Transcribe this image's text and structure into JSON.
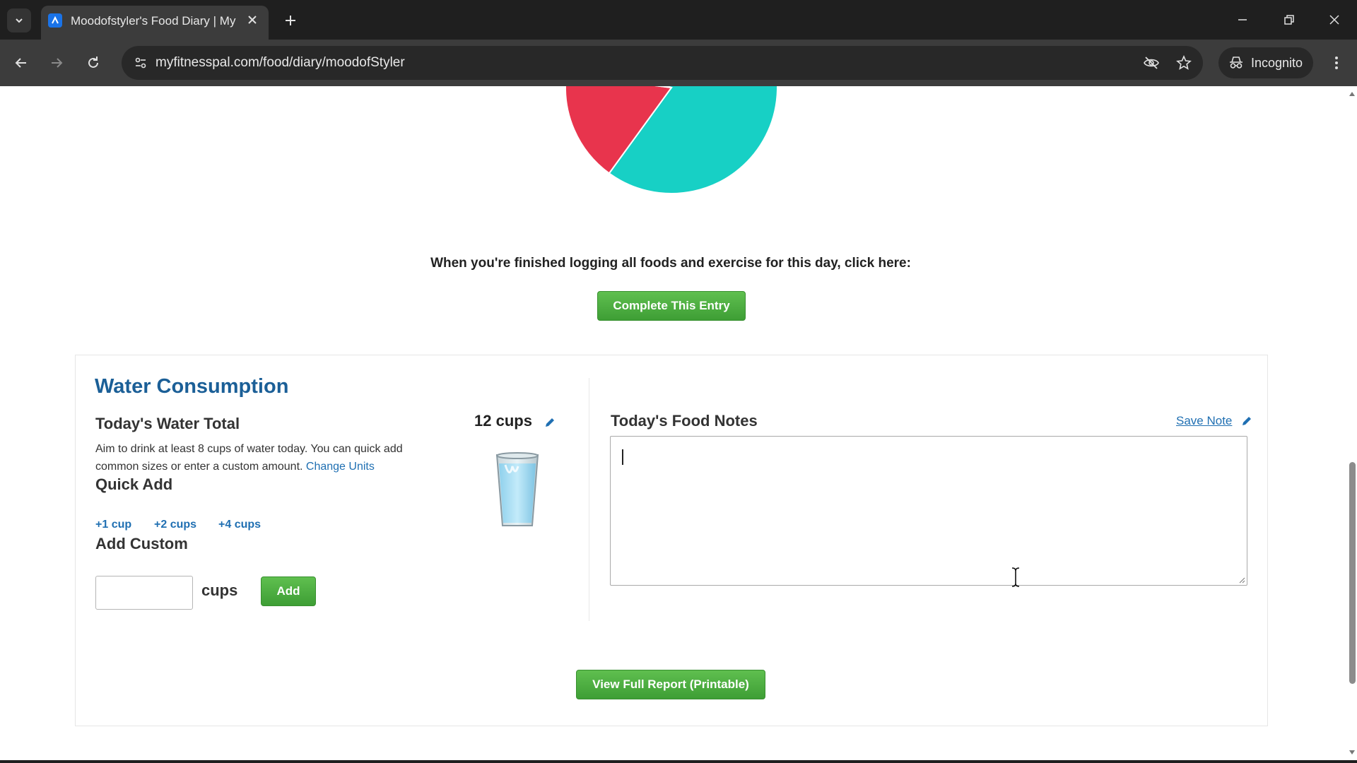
{
  "browser": {
    "tab_title": "Moodofstyler's Food Diary | My",
    "url": "myfitnesspal.com/food/diary/moodofStyler",
    "incognito_label": "Incognito"
  },
  "macro_pie": {
    "slices": [
      {
        "color": "#17d0c5",
        "fraction": 0.8
      },
      {
        "color": "#e8344d",
        "fraction": 0.17
      },
      {
        "color": "#b93ccf",
        "fraction": 0.03
      }
    ]
  },
  "entry": {
    "finish_prompt": "When you're finished logging all foods and exercise for this day, click here:",
    "complete_button": "Complete This Entry"
  },
  "water": {
    "title": "Water Consumption",
    "total_heading": "Today's Water Total",
    "description": "Aim to drink at least 8 cups of water today. You can quick add common sizes or enter a custom amount.",
    "change_units": "Change Units",
    "total_value": "12 cups",
    "quick_add_heading": "Quick Add",
    "quick_add": [
      "+1 cup",
      "+2 cups",
      "+4 cups"
    ],
    "add_custom_heading": "Add Custom",
    "custom_unit": "cups",
    "add_button": "Add"
  },
  "notes": {
    "title": "Today's Food Notes",
    "save_link": "Save Note",
    "value": ""
  },
  "report": {
    "button": "View Full Report (Printable)"
  },
  "colors": {
    "accent_green": "#4caf42",
    "link_blue": "#1f6fb2",
    "title_blue": "#1b5f97"
  }
}
